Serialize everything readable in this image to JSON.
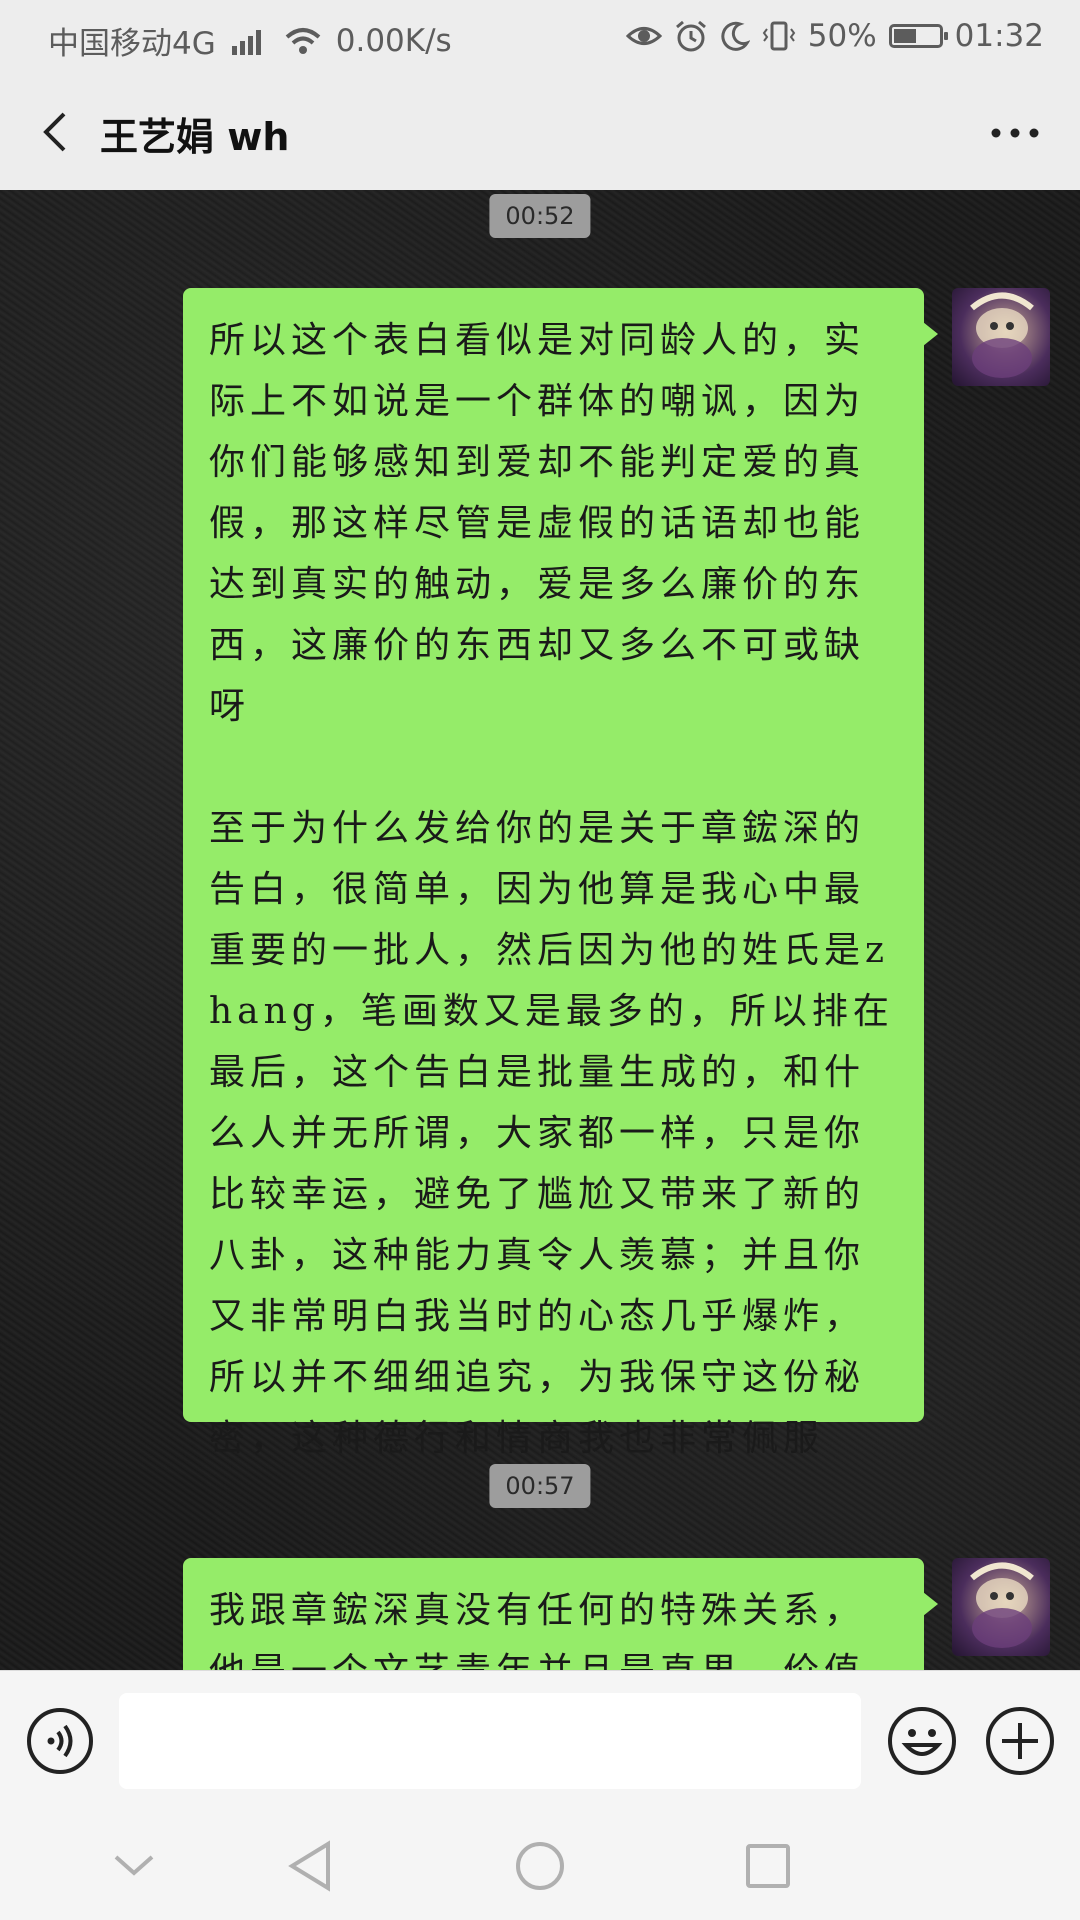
{
  "status_bar": {
    "carrier": "中国移动4G",
    "network_badge": "4G",
    "speed": "0.00K/s",
    "battery_percent": "50%",
    "battery_level": 0.5,
    "time": "01:32"
  },
  "header": {
    "title": "王艺娟 wh"
  },
  "messages": [
    {
      "time": "00:52",
      "text": "所以这个表白看似是对同龄人的，实际上不如说是一个群体的嘲讽，因为你们能够感知到爱却不能判定爱的真假，那这样尽管是虚假的话语却也能达到真实的触动，爱是多么廉价的东西，这廉价的东西却又多么不可或缺呀\n\n至于为什么发给你的是关于章鋐深的告白，很简单，因为他算是我心中最重要的一批人，然后因为他的姓氏是zhang，笔画数又是最多的，所以排在最后，这个告白是批量生成的，和什么人并无所谓，大家都一样，只是你比较幸运，避免了尴尬又带来了新的八卦，这种能力真令人羡慕；并且你又非常明白我当时的心态几乎爆炸，所以并不细细追究，为我保守这份秘密，这种德行和情商我也非常佩服"
    },
    {
      "time": "00:57",
      "text": "我跟章鋐深真没有任何的特殊关系，他是一个文艺青年并且是直男，价值观非"
    }
  ],
  "input": {
    "value": "",
    "placeholder": ""
  },
  "colors": {
    "bubble": "#95ec69",
    "bar_background": "#ededed",
    "timestamp": "#9d9d9d"
  }
}
